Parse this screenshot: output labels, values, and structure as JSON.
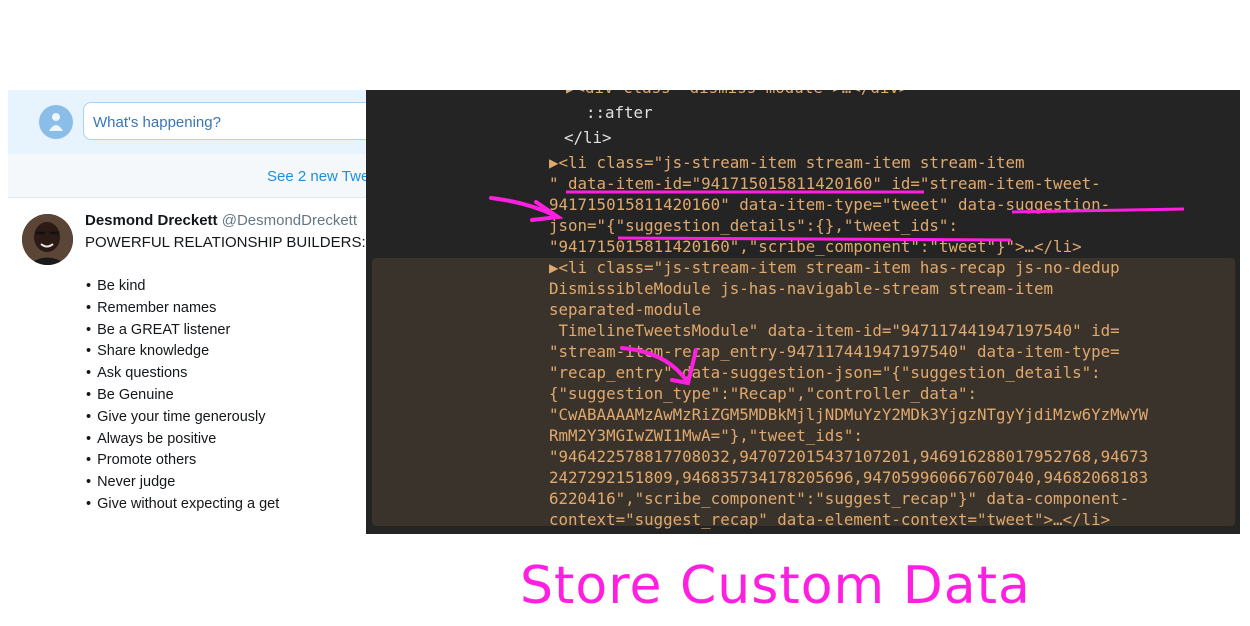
{
  "twitter": {
    "compose_placeholder": "What's happening?",
    "see_new_tweets": "See 2 new Twe",
    "tweet": {
      "name": "Desmond Dreckett",
      "handle": "@DesmondDreckett",
      "headline": "POWERFUL RELATIONSHIP BUILDERS:",
      "items": [
        "Be kind",
        "Remember names",
        "Be a GREAT listener",
        "Share knowledge",
        "Ask questions",
        "Be Genuine",
        "Give your time generously",
        "Always be positive",
        "Promote others",
        "Never judge",
        "Give without expecting a get"
      ]
    }
  },
  "devtools": {
    "lines": [
      "▶<div class=\"dismiss-module\">…</div>",
      "::after",
      "</li>",
      "▶<li class=\"js-stream-item stream-item stream-item",
      "\" data-item-id=\"941715015811420160\" id=\"stream-item-tweet-",
      "941715015811420160\" data-item-type=\"tweet\" data-suggestion-",
      "json=\"{\"suggestion_details\":{},\"tweet_ids\":",
      "\"941715015811420160\",\"scribe_component\":\"tweet\"}\">…</li>",
      "▶<li class=\"js-stream-item stream-item has-recap js-no-dedup",
      "DismissibleModule js-has-navigable-stream stream-item",
      "separated-module",
      " TimelineTweetsModule\" data-item-id=\"947117441947197540\" id=",
      "\"stream-item-recap_entry-947117441947197540\" data-item-type=",
      "\"recap_entry\" data-suggestion-json=\"{\"suggestion_details\":",
      "{\"suggestion_type\":\"Recap\",\"controller_data\":",
      "\"CwABAAAAMzAwMzRiZGM5MDBkMjljNDMuYzY2MDk3YjgzNTgyYjdiMzw6YzMwYW",
      "RmM2Y3MGIwZWI1MwA=\"},\"tweet_ids\":",
      "\"946422578817708032,947072015437107201,946916288017952768,94673",
      "2427292151809,946835734178205696,947059960667607040,94682068183",
      "6220416\",\"scribe_component\":\"suggest_recap\"}\" data-component-",
      "context=\"suggest_recap\" data-element-context=\"tweet\">…</li>"
    ]
  },
  "caption": "Store Custom Data",
  "colors": {
    "annotation": "#ff1fe0",
    "devtools_bg": "#242424",
    "highlight_bg": "#3a332b",
    "twitter_blue": "#1d8fe0"
  }
}
